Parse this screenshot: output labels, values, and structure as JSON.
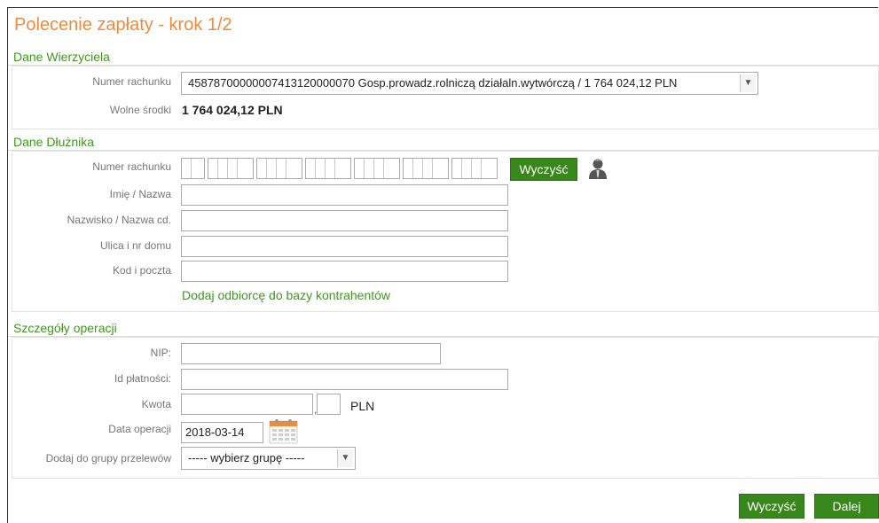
{
  "page": {
    "title": "Polecenie zapłaty - krok 1/2"
  },
  "creditor": {
    "section_title": "Dane Wierzyciela",
    "account_label": "Numer rachunku",
    "account_value": "45878700000007413120000070 Gosp.prowadz.rolniczą działaln.wytwórczą / 1 764 024,12 PLN",
    "funds_label": "Wolne środki",
    "funds_value": "1 764 024,12 PLN"
  },
  "debtor": {
    "section_title": "Dane Dłużnika",
    "account_label": "Numer rachunku",
    "clear_button": "Wyczyść",
    "name_label": "Imię / Nazwa",
    "surname_label": "Nazwisko / Nazwa cd.",
    "street_label": "Ulica i nr domu",
    "postal_label": "Kod i poczta",
    "add_link": "Dodaj odbiorcę do bazy kontrahentów"
  },
  "details": {
    "section_title": "Szczegóły operacji",
    "nip_label": "NIP:",
    "payment_id_label": "Id płatności:",
    "amount_label": "Kwota",
    "currency": "PLN",
    "date_label": "Data operacji",
    "date_value": "2018-03-14",
    "group_label": "Dodaj do grupy przelewów",
    "group_value": "----- wybierz grupę -----"
  },
  "footer": {
    "clear_button": "Wyczyść",
    "next_button": "Dalej"
  }
}
